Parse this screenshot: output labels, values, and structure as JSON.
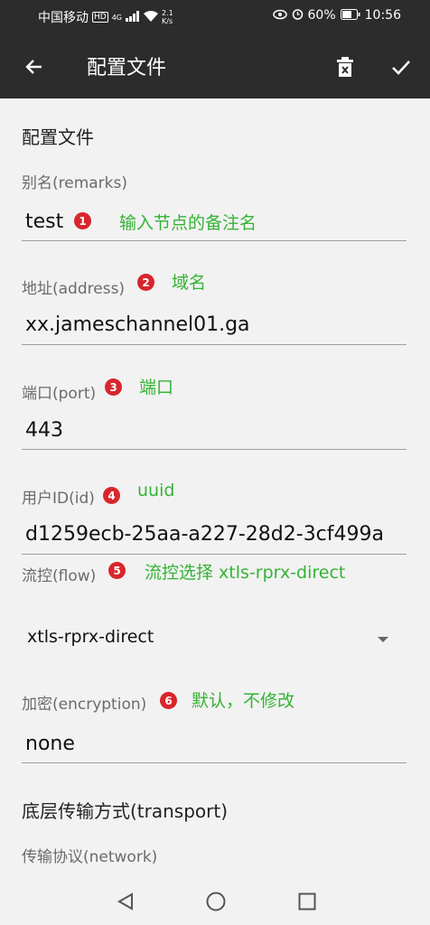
{
  "status_bar": {
    "carrier": "中国移动",
    "hd": "HD",
    "signal_type": "4G",
    "speed": "2.1",
    "speed_unit": "K/s",
    "battery": "60%",
    "time": "10:56"
  },
  "app_bar": {
    "title": "配置文件"
  },
  "form": {
    "section_title": "配置文件",
    "remarks": {
      "label": "别名(remarks)",
      "value": "test",
      "badge": "1",
      "note": "输入节点的备注名"
    },
    "address": {
      "label": "地址(address)",
      "value": "xx.jameschannel01.ga",
      "badge": "2",
      "note": "域名"
    },
    "port": {
      "label": "端口(port)",
      "value": "443",
      "badge": "3",
      "note": "端口"
    },
    "id": {
      "label": "用户ID(id)",
      "value": "d1259ecb-25aa-a227-28d2-3cf499a",
      "badge": "4",
      "note": "uuid"
    },
    "flow": {
      "label": "流控(flow)",
      "value": "xtls-rprx-direct",
      "badge": "5",
      "note": "流控选择 xtls-rprx-direct"
    },
    "encryption": {
      "label": "加密(encryption)",
      "value": "none",
      "badge": "6",
      "note": "默认，不修改"
    },
    "transport_title": "底层传输方式(transport)",
    "network_label": "传输协议(network)"
  },
  "colors": {
    "appbar_bg": "#2c2c2c",
    "badge_red": "#d8262c",
    "note_green": "#35b335"
  },
  "icons": {
    "back": "arrow-left",
    "delete": "trash",
    "confirm": "checkmark",
    "nav_back": "triangle",
    "nav_home": "circle",
    "nav_recent": "square"
  }
}
